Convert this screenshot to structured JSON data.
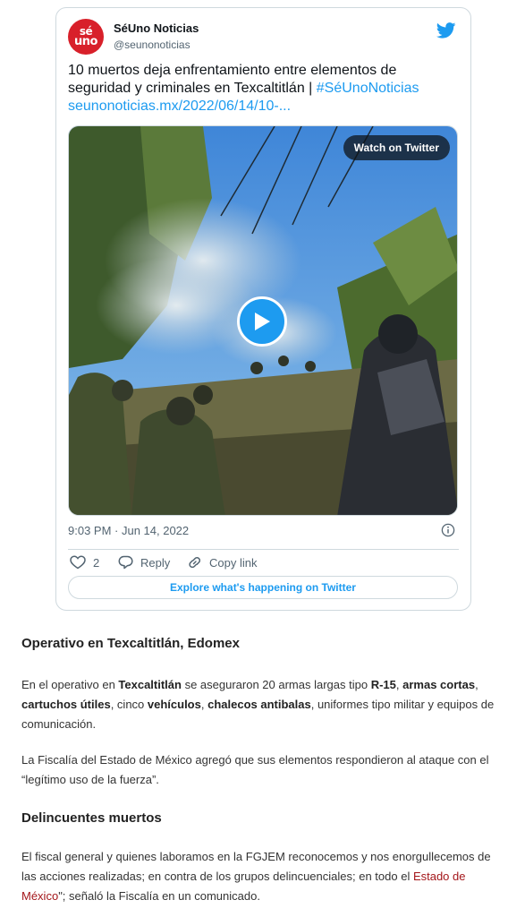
{
  "tweet": {
    "avatar_line1": "sé",
    "avatar_line2": "uno",
    "author_name": "SéUno Noticias",
    "author_handle": "@seunonoticias",
    "text_main": "10 muertos deja enfrentamiento entre elementos de seguridad y criminales  en Texcaltitlán | ",
    "hashtag": "#SéUnoNoticias",
    "url": "seunonoticias.mx/2022/06/14/10-...",
    "watch_label": "Watch on Twitter",
    "timestamp": "9:03 PM · Jun 14, 2022",
    "like_count": "2",
    "reply_label": "Reply",
    "copy_label": "Copy link",
    "explore_label": "Explore what's happening on Twitter",
    "brand_color": "#1d9bf0",
    "icons": [
      "twitter-bird-icon",
      "play-icon",
      "info-icon",
      "heart-icon",
      "reply-icon",
      "link-icon"
    ]
  },
  "article": {
    "heading1": "Operativo en Texcaltitlán, Edomex",
    "p1": {
      "a": "En el operativo en ",
      "link": "Texcaltitlán",
      "b": " se aseguraron 20 armas largas tipo ",
      "bold1": "R-15",
      "c": ", ",
      "bold2": "armas cortas",
      "d": ", ",
      "bold3": "cartuchos útiles",
      "e": ", cinco ",
      "bold4": "vehículos",
      "f": ", ",
      "bold5": "chalecos antibalas",
      "g": ", uniformes tipo militar y equipos de comunicación."
    },
    "p2": "La Fiscalía del Estado de México agregó que sus elementos respondieron al ataque con el “legítimo uso de la fuerza”.",
    "heading2": "Delincuentes muertos",
    "p3": {
      "a": "El fiscal general y quienes laboramos en la FGJEM reconocemos y nos enorgullecemos de las acciones realizadas; en contra de los grupos delincuenciales; en todo el ",
      "link": "Estado de México",
      "b": "\"; señaló la Fiscalía en un comunicado."
    },
    "link_color": "#a4161a"
  }
}
